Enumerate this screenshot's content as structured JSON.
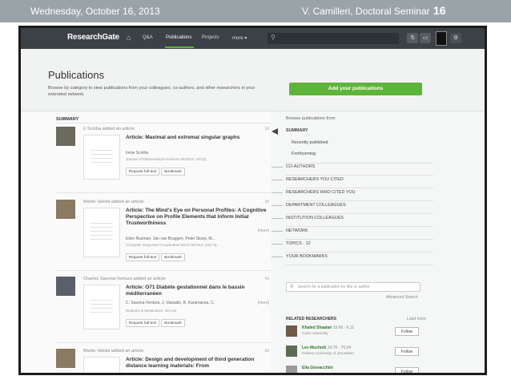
{
  "slide": {
    "date": "Wednesday, October 16, 2013",
    "author": "V. Camilleri, Doctoral Seminar",
    "page": "16"
  },
  "nav": {
    "logo": "ResearchGate",
    "items": [
      "Q&A",
      "Publications",
      "Projects",
      "more ▾"
    ],
    "active": "Publications"
  },
  "header": {
    "title": "Publications",
    "description": "Browse by category to view publications from your colleagues, co-authors, and other researchers in your extended network.",
    "add_button": "Add your publications"
  },
  "feed": {
    "summary_label": "SUMMARY",
    "entries": [
      {
        "adder": "Ir Sciriha added an article:",
        "age": "2d",
        "title": "Article: Maximal and extremal singular graphs",
        "authors": "Irene Sciriha",
        "journal": "Journal of Mathematical Sciences 06/2013; 192(2).",
        "more": "",
        "buttons": [
          "Request full-text",
          "Bookmark"
        ]
      },
      {
        "adder": "Martin Valcke added an article:",
        "age": "3d",
        "title": "Article: The Mind's Eye on Personal Profiles: A Cognitive Perspective on Profile Elements that Inform Initial Trustworthiness",
        "authors": "Elien Rusman, Jan van Bruggen, Peter Sloep, M...",
        "journal": "Computer Supported Cooperative Work 06/2013; 22(2-3).",
        "more": "[more]",
        "buttons": [
          "Request full-text",
          "Bookmark"
        ]
      },
      {
        "adder": "Charles Savona-Ventura added an article:",
        "age": "4d",
        "title": "Article: O71 Diabète gestationnel dans le bassin méditerranéen",
        "authors": "C. Savona-Ventura, J. Vassallo, B. Karamanos, C.",
        "journal": "Diabetes & Metabolism. 38:A18.",
        "more": "[more]",
        "buttons": [
          "Request full-text",
          "Bookmark"
        ]
      },
      {
        "adder": "Martin Valcke added an article:",
        "age": "6d",
        "title": "Article: Design and development of third generation distance learning materials: From",
        "authors": "",
        "journal": "",
        "more": "",
        "buttons": []
      }
    ]
  },
  "sidebar": {
    "browse_label": "Browse publications from",
    "items": [
      {
        "label": "SUMMARY",
        "bold": true
      },
      {
        "label": "Recently published",
        "sub": true
      },
      {
        "label": "Forthcoming",
        "sub": true
      },
      {
        "label": "CO-AUTHORS"
      },
      {
        "label": "RESEARCHERS YOU CITED"
      },
      {
        "label": "RESEARCHERS WHO CITED YOU"
      },
      {
        "label": "DEPARTMENT COLLEAGUES"
      },
      {
        "label": "INSTITUTION COLLEAGUES"
      },
      {
        "label": "NETWORK"
      },
      {
        "label": "TOPICS · 12"
      },
      {
        "label": "YOUR BOOKMARKS"
      }
    ],
    "search_placeholder": "Search for a publication by title or author",
    "advanced_search": "Advanced Search",
    "related_title": "RELATED RESEARCHERS",
    "load_more": "Load more",
    "researchers": [
      {
        "name": "Khaled Shaalan",
        "stats": "19.06 · 6.11",
        "affiliation": "Cairo University",
        "follow": "Follow"
      },
      {
        "name": "Lev Muchnik",
        "stats": "19.76 · 76.04",
        "affiliation": "Hebrew University of Jerusalem",
        "follow": "Follow"
      },
      {
        "name": "Elia Giovacchini",
        "stats": "",
        "affiliation": "",
        "follow": "Follow"
      }
    ]
  }
}
